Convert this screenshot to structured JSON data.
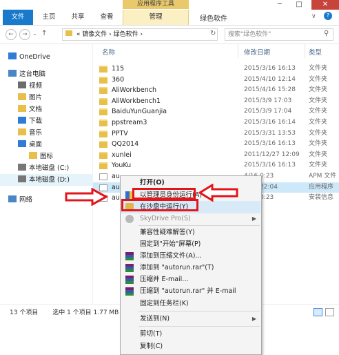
{
  "window": {
    "title": "绿色软件",
    "context_tab_header": "应用程序工具",
    "minimize_glyph": "─",
    "maximize_glyph": "□",
    "close_glyph": "✕",
    "help_glyph": "?"
  },
  "ribbon": {
    "tabs": [
      "文件",
      "主页",
      "共享",
      "查看",
      "管理"
    ],
    "expand_glyph": "∨"
  },
  "nav": {
    "back_glyph": "←",
    "forward_glyph": "→",
    "up_glyph": "↑",
    "recent_glyph": "⌄",
    "refresh_glyph": "↻",
    "breadcrumb_prefix": "«",
    "breadcrumb": [
      "镜像文件",
      "绿色软件"
    ],
    "breadcrumb_sep": "›",
    "search_placeholder": "搜索\"绿色软件\"",
    "search_glyph": "⚲"
  },
  "sidebar": {
    "items": [
      {
        "label": "OneDrive",
        "icon": "cloud-icon"
      },
      {
        "label": "这台电脑",
        "icon": "computer-icon"
      },
      {
        "label": "视频",
        "icon": "video-folder-icon"
      },
      {
        "label": "图片",
        "icon": "picture-folder-icon"
      },
      {
        "label": "文档",
        "icon": "document-folder-icon"
      },
      {
        "label": "下载",
        "icon": "download-folder-icon"
      },
      {
        "label": "音乐",
        "icon": "music-folder-icon"
      },
      {
        "label": "桌面",
        "icon": "desktop-folder-icon"
      },
      {
        "label": "图标",
        "icon": "folder-icon"
      },
      {
        "label": "本地磁盘 (C:)",
        "icon": "drive-icon"
      },
      {
        "label": "本地磁盘 (D:)",
        "icon": "drive-icon"
      },
      {
        "label": "网络",
        "icon": "network-icon"
      }
    ]
  },
  "columns": {
    "name": "名称",
    "date": "修改日期",
    "type": "类型"
  },
  "files": [
    {
      "name": "115",
      "date": "2015/3/16 16:13",
      "type": "文件夹",
      "icon": "folder-icon"
    },
    {
      "name": "360",
      "date": "2015/4/10 12:14",
      "type": "文件夹",
      "icon": "folder-icon"
    },
    {
      "name": "AliWorkbench",
      "date": "2015/4/16 15:28",
      "type": "文件夹",
      "icon": "folder-icon"
    },
    {
      "name": "AliWorkbench1",
      "date": "2015/3/9 17:03",
      "type": "文件夹",
      "icon": "folder-icon"
    },
    {
      "name": "BaiduYunGuanjia",
      "date": "2015/3/9 17:04",
      "type": "文件夹",
      "icon": "folder-icon"
    },
    {
      "name": "ppstream3",
      "date": "2015/3/16 16:14",
      "type": "文件夹",
      "icon": "folder-icon"
    },
    {
      "name": "PPTV",
      "date": "2015/3/31 13:53",
      "type": "文件夹",
      "icon": "folder-icon"
    },
    {
      "name": "QQ2014",
      "date": "2015/3/16 16:13",
      "type": "文件夹",
      "icon": "folder-icon"
    },
    {
      "name": "xunlei",
      "date": "2011/12/27 12:09",
      "type": "文件夹",
      "icon": "folder-icon"
    },
    {
      "name": "YouKu",
      "date": "2015/3/16 16:13",
      "type": "文件夹",
      "icon": "folder-icon"
    },
    {
      "name": "au",
      "date": "4/16 0:23",
      "type": "APM 文件",
      "icon": "file-icon"
    },
    {
      "name": "au",
      "date": "7/22 22:04",
      "type": "应用程序",
      "icon": "app-icon",
      "selected": true
    },
    {
      "name": "au",
      "date": "4/16 0:23",
      "type": "安装信息",
      "icon": "settings-file-icon"
    }
  ],
  "status": {
    "count": "13 个项目",
    "selection": "选中 1 个项目  1.77 MB"
  },
  "context_menu": {
    "items": [
      {
        "label": "打开(O)",
        "bold": true
      },
      {
        "label": "以管理员身份运行(A)",
        "icon": "shield-icon"
      },
      {
        "label": "在沙盘中运行(Y)",
        "icon": "sandbox-icon",
        "highlight": true
      },
      {
        "label": "SkyDrive Pro(S)",
        "icon": "skydrive-icon",
        "disabled": true,
        "submenu": true
      },
      {
        "label": "兼容性疑难解答(Y)"
      },
      {
        "label": "固定到\"开始\"屏幕(P)"
      },
      {
        "label": "添加到压缩文件(A)...",
        "icon": "winrar-icon"
      },
      {
        "label": "添加到 \"autorun.rar\"(T)",
        "icon": "winrar-icon"
      },
      {
        "label": "压缩并 E-mail...",
        "icon": "winrar-icon"
      },
      {
        "label": "压缩到 \"autorun.rar\" 并 E-mail",
        "icon": "winrar-icon"
      },
      {
        "label": "固定到任务栏(K)"
      },
      {
        "label": "发送到(N)",
        "submenu": true
      },
      {
        "label": "剪切(T)"
      },
      {
        "label": "复制(C)"
      }
    ],
    "submenu_glyph": "▶"
  },
  "colors": {
    "ribbon_file_tab": "#1979ca",
    "context_tab": "#e9c96b",
    "selection": "#cde8f9",
    "annotation_red": "#e4141b",
    "close_button": "#c7443c"
  }
}
